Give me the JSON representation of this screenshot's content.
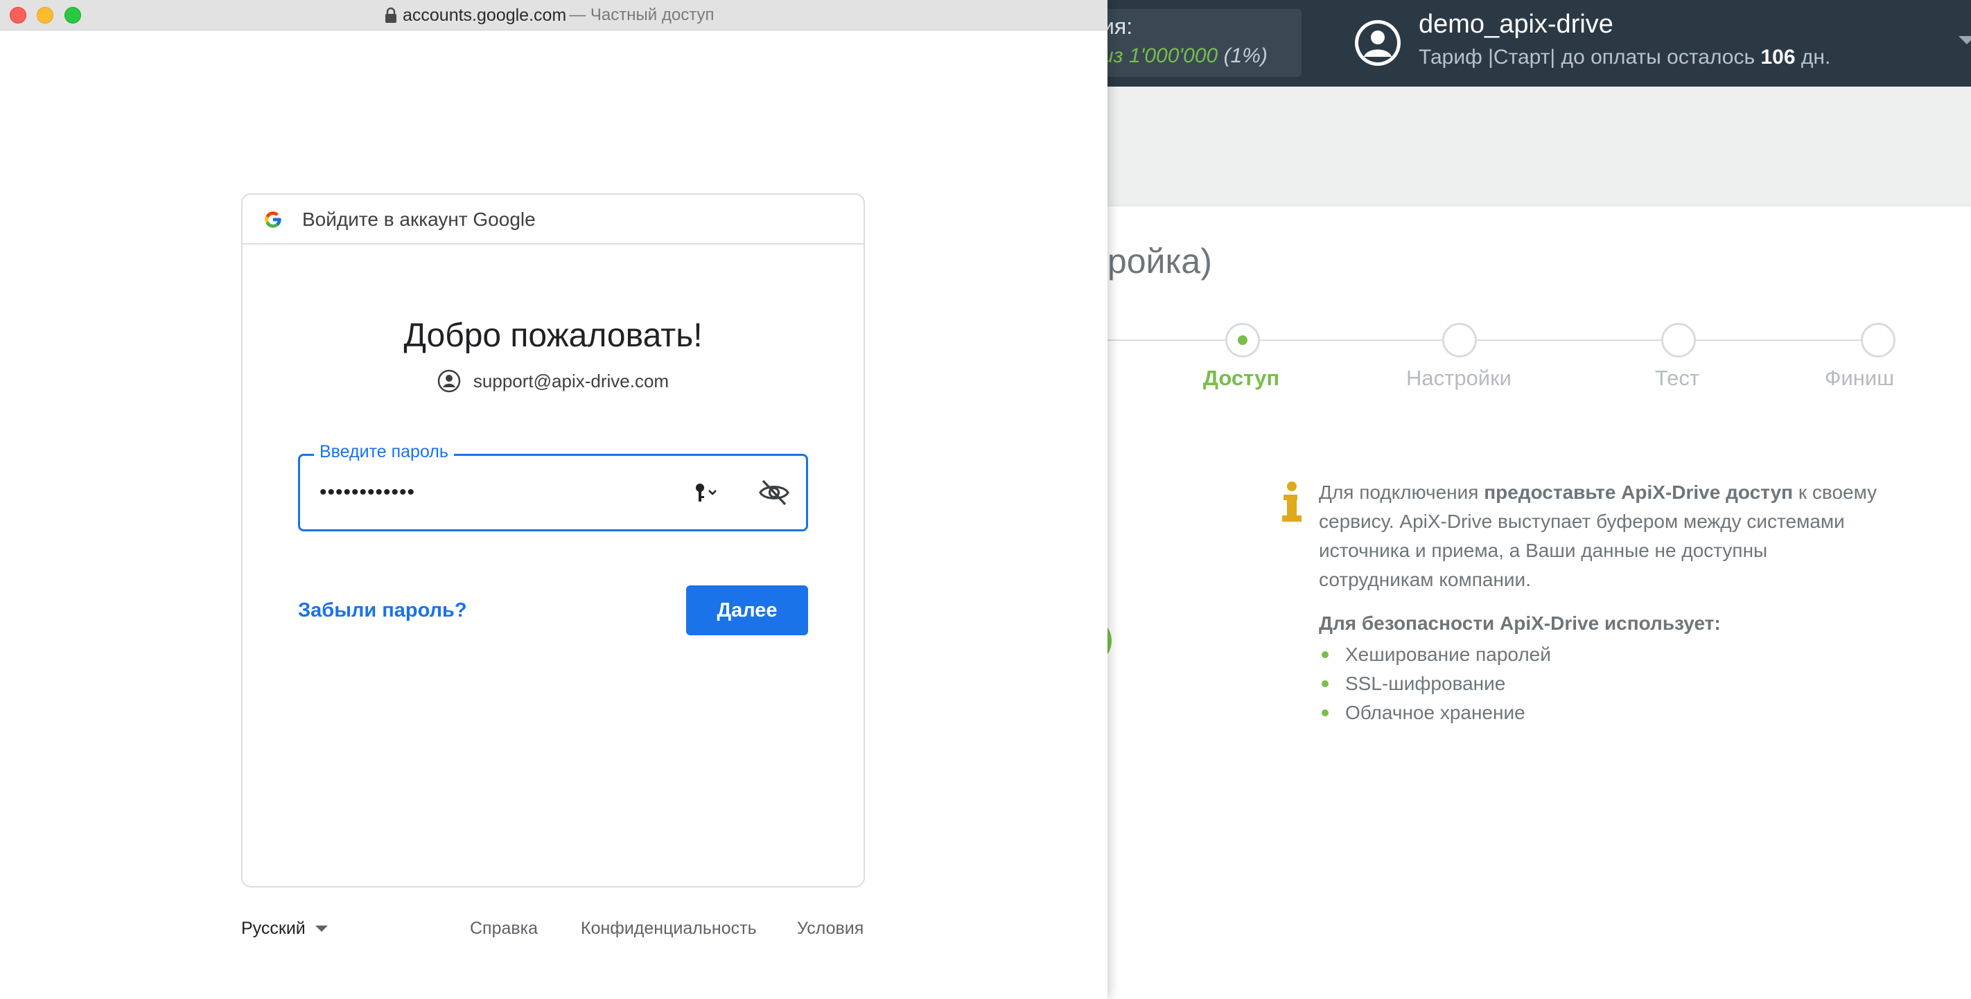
{
  "background_app": {
    "stats": {
      "label": "ия:",
      "value_prefix": "из 1'000'000",
      "value_percent": "(1%)"
    },
    "user": {
      "name": "demo_apix-drive",
      "plan_prefix": "Тариф |Старт| до оплаты осталось",
      "plan_days": "106",
      "plan_suffix": "дн."
    },
    "page_title": "стройка)",
    "steps": [
      {
        "label": "Доступ",
        "active": true
      },
      {
        "label": "Настройки",
        "active": false
      },
      {
        "label": "Тест",
        "active": false
      },
      {
        "label": "Финиш",
        "active": false
      }
    ],
    "info": {
      "text_start": "Для подключения ",
      "text_bold": "предоставьте ApiX-Drive доступ",
      "text_end": " к своему сервису. ApiX-Drive выступает буфером между системами источника и приема, а Ваши данные не доступны сотрудникам компании.",
      "security_title": "Для безопасности ApiX-Drive использует:",
      "security_items": [
        "Хеширование паролей",
        "SSL-шифрование",
        "Облачное хранение"
      ]
    },
    "colors": {
      "accent_green": "#79bd4c",
      "header_bg": "#2b3945",
      "info_icon": "#e0a81b"
    }
  },
  "browser": {
    "domain": "accounts.google.com",
    "suffix": "— Частный доступ"
  },
  "google": {
    "header_text": "Войдите в аккаунт Google",
    "welcome": "Добро пожаловать!",
    "email": "support@apix-drive.com",
    "password_label": "Введите пароль",
    "password_value": "••••••••••••",
    "forgot_label": "Забыли пароль?",
    "next_label": "Далее",
    "footer": {
      "language": "Русский",
      "help": "Справка",
      "privacy": "Конфиденциальность",
      "terms": "Условия"
    },
    "colors": {
      "primary_blue": "#1a73e8"
    }
  }
}
